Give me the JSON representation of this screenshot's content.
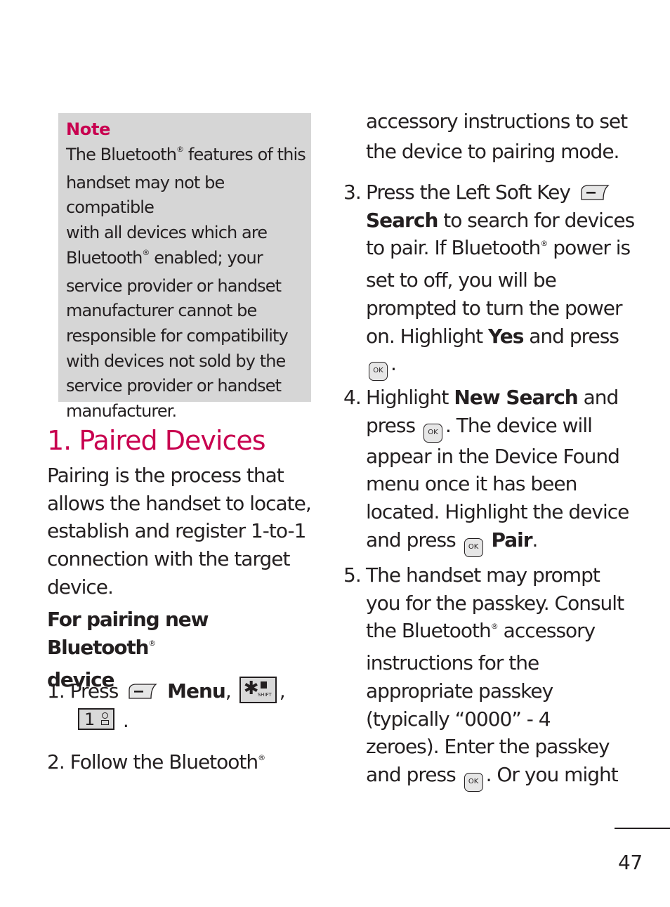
{
  "note": {
    "title": "Note",
    "lines": [
      [
        "The Bluetooth",
        "®",
        " features of this"
      ],
      [
        "handset may not be compatible"
      ],
      [
        "with all devices which are"
      ],
      [
        "Bluetooth",
        "®",
        " enabled; your"
      ],
      [
        "service provider or handset"
      ],
      [
        "manufacturer cannot be"
      ],
      [
        "responsible for compatibility"
      ],
      [
        "with devices not sold by the"
      ],
      [
        "service provider or handset"
      ],
      [
        "manufacturer."
      ]
    ]
  },
  "section": {
    "heading": "1. Paired Devices",
    "intro_lines": [
      "Pairing is the process that",
      "allows the handset to locate,",
      "establish and register 1-to-1",
      "connection with the target",
      "device."
    ],
    "subheading_line1": "For pairing new Bluetooth",
    "subheading_reg": "®",
    "subheading_line2": "device"
  },
  "steps": {
    "s1": {
      "num": "1.",
      "press": "Press",
      "menu": "Menu",
      "comma": ",",
      "period": ".",
      "key_star_glyph": "✱",
      "key_star_sub": "SHIFT",
      "key_one": "1"
    },
    "s2": {
      "num": "2.",
      "text": "Follow the Bluetooth",
      "reg": "®"
    },
    "s2_cont": {
      "line1": "accessory instructions to set",
      "line2": "the device to pairing mode."
    },
    "s3": {
      "num": "3.",
      "l1": "Press the Left Soft Key",
      "l2_bold": "Search",
      "l2_rest": " to search for devices",
      "l3a": "to pair. If Bluetooth",
      "reg": "®",
      "l3b": " power is",
      "l4": "set to off, you will be",
      "l5": "prompted to turn the power",
      "l6a": "on. Highlight ",
      "l6_bold": "Yes",
      "l6b": " and press",
      "l7": "."
    },
    "s4": {
      "num": "4.",
      "l1a": "Highlight ",
      "l1_bold": "New Search",
      "l1b": " and",
      "l2a": "press",
      "l2b": ". The device will",
      "l3": "appear in the Device Found",
      "l4": "menu once it has been",
      "l5": "located. Highlight the device",
      "l6a": "and press",
      "l6_bold": "Pair",
      "l6b": "."
    },
    "s5": {
      "num": "5.",
      "l1": "The handset may prompt",
      "l2": "you for the passkey. Consult",
      "l3a": "the Bluetooth",
      "reg": "®",
      "l3b": " accessory",
      "l4": "instructions for the",
      "l5": "appropriate passkey",
      "l6": "(typically “0000” - 4",
      "l7": "zeroes). Enter the passkey",
      "l8a": "and press",
      "l8b": ". Or you might"
    },
    "ok_label": "OK"
  },
  "footer": {
    "page_number": "47"
  },
  "colors": {
    "accent": "#c8004f",
    "note_bg": "#d6d6d6",
    "text": "#231f20"
  }
}
